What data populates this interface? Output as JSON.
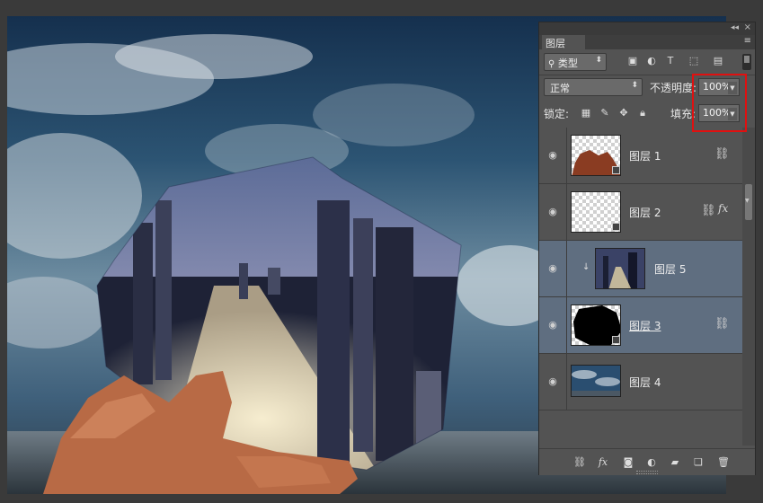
{
  "panel": {
    "tab_label": "图层",
    "menu_icon": "panel-menu-icon",
    "collapse_icon": "collapse-arrows-icon",
    "filter": {
      "label": "类型",
      "icons": [
        "image-filter-icon",
        "adjustment-filter-icon",
        "type-filter-icon",
        "shape-filter-icon",
        "smart-object-filter-icon"
      ]
    },
    "blend_mode": "正常",
    "opacity_label": "不透明度:",
    "opacity_value": "100%",
    "lock_label": "锁定:",
    "fill_label": "填充:",
    "fill_value": "100%",
    "layers": [
      {
        "name": "图层 1",
        "linked": true,
        "fx": false,
        "clipped": false,
        "selected": false
      },
      {
        "name": "图层 2",
        "linked": true,
        "fx": true,
        "fx_label": "fx",
        "clipped": false,
        "selected": false
      },
      {
        "name": "图层 5",
        "linked": false,
        "fx": false,
        "clipped": true,
        "selected": true
      },
      {
        "name": "图层 3",
        "linked": true,
        "fx": false,
        "clipped": false,
        "selected": true
      },
      {
        "name": "图层 4",
        "linked": false,
        "fx": false,
        "clipped": false,
        "selected": false
      }
    ],
    "bottom_icons": [
      "link-layers-icon",
      "fx-icon",
      "add-mask-icon",
      "adjustment-layer-icon",
      "new-group-icon",
      "new-layer-icon",
      "trash-icon"
    ],
    "bottom_fx_label": "fx"
  },
  "colors": {
    "highlight": "#e01010",
    "selected_row": "#5f6e80",
    "panel_bg": "#535353"
  }
}
